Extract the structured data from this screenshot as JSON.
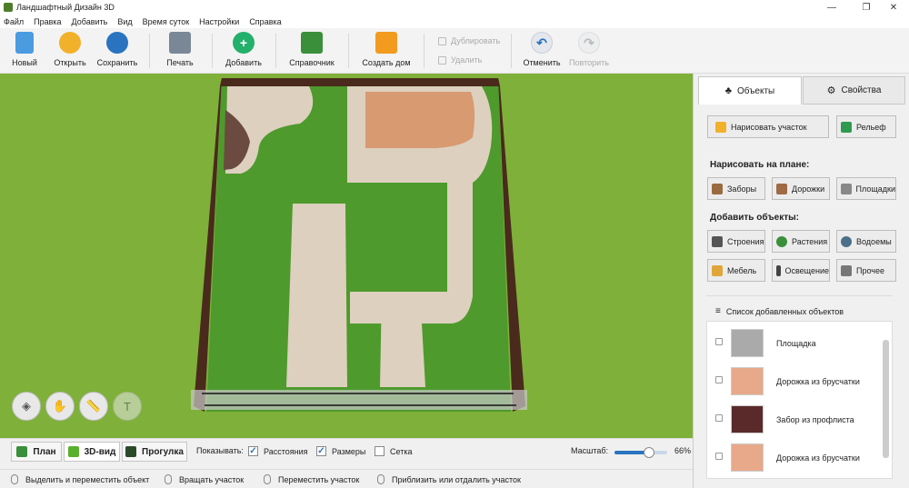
{
  "app": {
    "title": "Ландшафтный Дизайн 3D"
  },
  "menu": [
    "Файл",
    "Правка",
    "Добавить",
    "Вид",
    "Время суток",
    "Настройки",
    "Справка"
  ],
  "toolbar": {
    "new": "Новый",
    "open": "Открыть",
    "save": "Сохранить",
    "print": "Печать",
    "add": "Добавить",
    "reference": "Справочник",
    "create_house": "Создать дом",
    "duplicate": "Дублировать",
    "delete": "Удалить",
    "undo": "Отменить",
    "redo": "Повторить"
  },
  "panel": {
    "tabs": {
      "objects": "Объекты",
      "properties": "Свойства"
    },
    "draw_plot": "Нарисовать участок",
    "relief": "Рельеф",
    "draw_on_plan": "Нарисовать на плане:",
    "draw_items": [
      "Заборы",
      "Дорожки",
      "Площадки"
    ],
    "add_objects": "Добавить объекты:",
    "add_items": [
      "Строения",
      "Растения",
      "Водоемы",
      "Мебель",
      "Освещение",
      "Прочее"
    ],
    "list_title": "Список добавленных объектов",
    "list_items": [
      "Площадка",
      "Дорожка из брусчатки",
      "Забор из профлиста",
      "Дорожка из брусчатки"
    ]
  },
  "views": {
    "plan": "План",
    "view3d": "3D-вид",
    "walk": "Прогулка"
  },
  "show": {
    "label": "Показывать:",
    "distances": "Расстояния",
    "sizes": "Размеры",
    "grid": "Сетка",
    "distances_checked": true,
    "sizes_checked": true,
    "grid_checked": false
  },
  "zoom": {
    "label": "Масштаб:",
    "value": "66%",
    "level": 0.66
  },
  "status": [
    "Выделить и переместить объект",
    "Вращать участок",
    "Переместить участок",
    "Приблизить или отдалить участок"
  ],
  "colors": {
    "grass": "#7fb03a",
    "lawn": "#4e9a2c",
    "fence": "#4a2a1c",
    "path": "#ddd0bf",
    "brick": "#d89a70",
    "soil": "#6b4a40",
    "accent": "#2a73c0"
  }
}
